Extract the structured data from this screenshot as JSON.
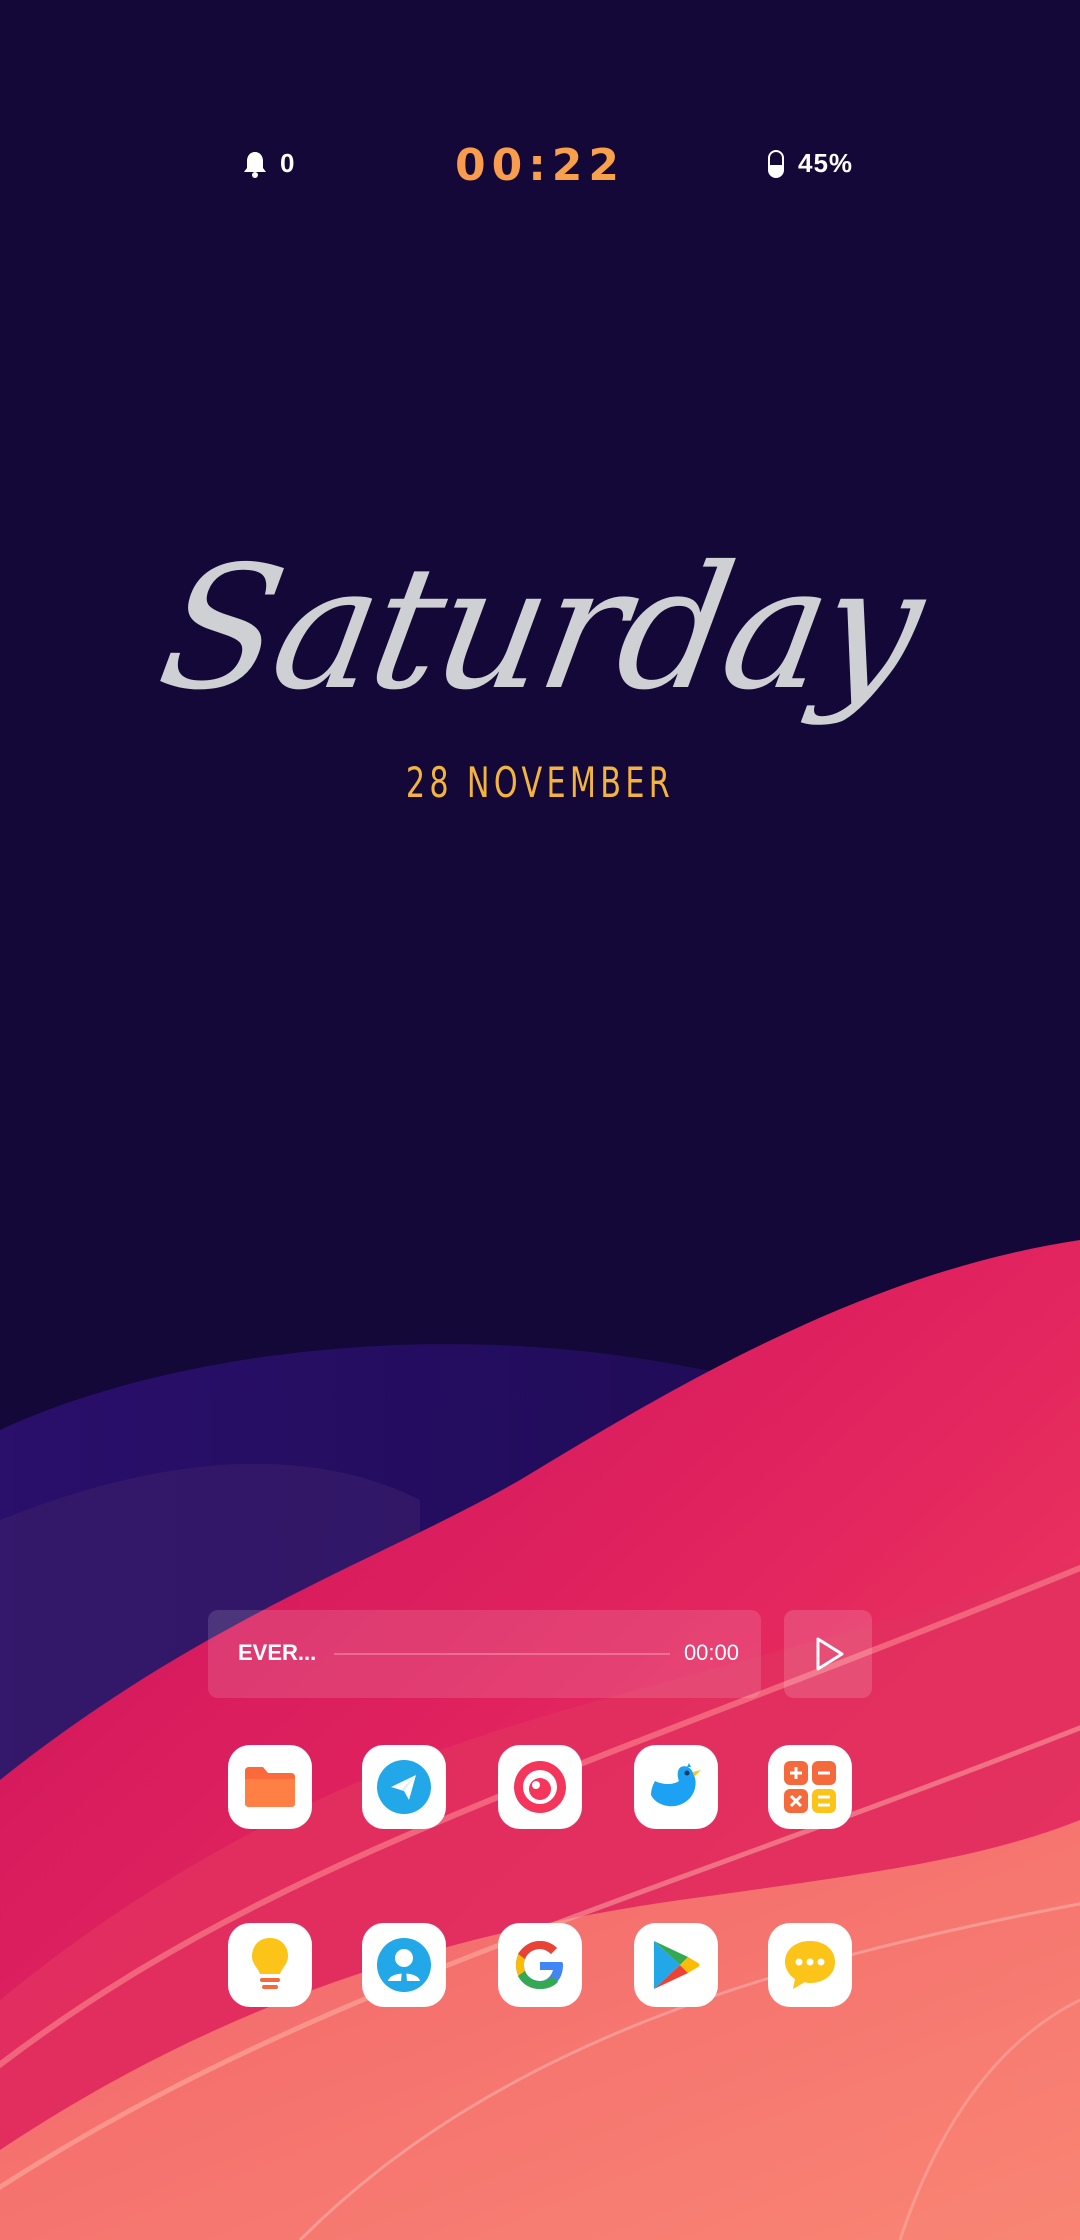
{
  "status_bar": {
    "notifications": "0",
    "time": "00:22",
    "battery": "45%",
    "battery_level": 0.45
  },
  "date_widget": {
    "day": "Saturday",
    "date": "28 NOVEMBER"
  },
  "music_player": {
    "track": "EVER...",
    "time": "00:00",
    "progress": 0,
    "play_icon": "play-icon"
  },
  "apps": {
    "row1": [
      {
        "name": "file-manager",
        "icon": "folder-icon",
        "color": "#fb6a3a"
      },
      {
        "name": "telegram",
        "icon": "paper-plane-icon",
        "color": "#22a7e8"
      },
      {
        "name": "camera",
        "icon": "camera-lens-icon",
        "color": "#f5365c"
      },
      {
        "name": "twitter",
        "icon": "bird-icon",
        "color": "#1da1f2"
      },
      {
        "name": "calculator",
        "icon": "calculator-icon",
        "color": "#f56a3d"
      }
    ],
    "row2": [
      {
        "name": "tips",
        "icon": "lightbulb-icon",
        "color": "#fcc419"
      },
      {
        "name": "contacts",
        "icon": "person-icon",
        "color": "#22a7e8"
      },
      {
        "name": "google",
        "icon": "google-g-icon",
        "color": "#4285f4"
      },
      {
        "name": "play-store",
        "icon": "play-store-icon",
        "color": "#34a853"
      },
      {
        "name": "messages",
        "icon": "chat-bubble-icon",
        "color": "#fcc419"
      }
    ]
  }
}
